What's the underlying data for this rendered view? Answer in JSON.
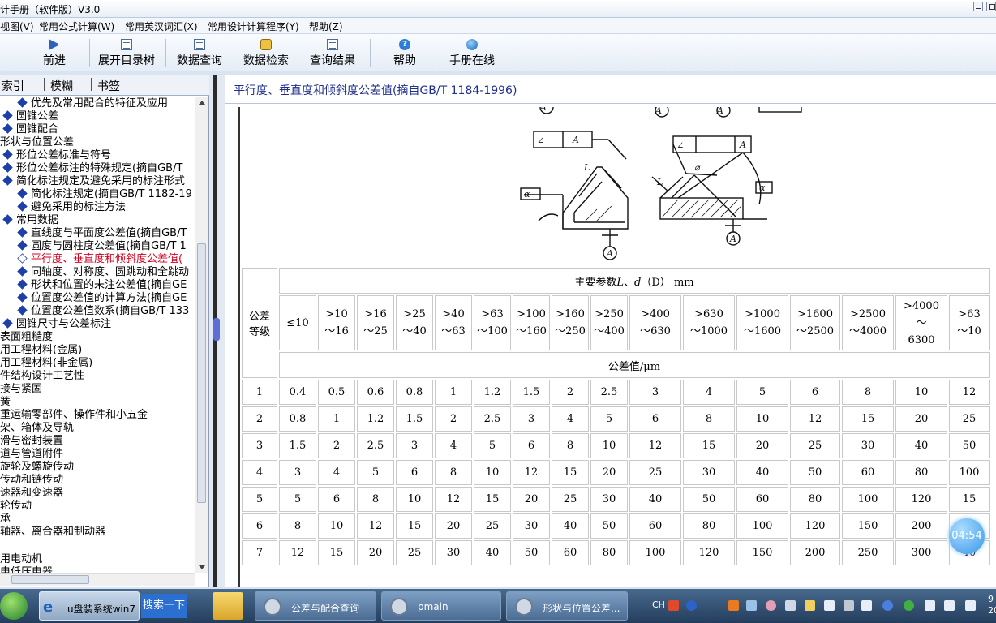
{
  "window": {
    "title": "计手册（软件版）V3.0"
  },
  "menu": [
    "视图(V)",
    "常用公式计算(W)",
    "常用英汉词汇(X)",
    "常用设计计算程序(Y)",
    "帮助(Z)"
  ],
  "toolbar": {
    "forward": "前进",
    "expand": "展开目录树",
    "query": "数据查询",
    "search": "数据检索",
    "result": "查询结果",
    "help": "帮助",
    "online": "手册在线"
  },
  "tabs": [
    "索引",
    "模糊",
    "书签"
  ],
  "tree": [
    {
      "label": "优先及常用配合的特征及应用",
      "level": 2
    },
    {
      "label": "圆锥公差",
      "level": 1
    },
    {
      "label": "圆锥配合",
      "level": 1
    },
    {
      "label": "形状与位置公差",
      "level": 0
    },
    {
      "label": "形位公差标准与符号",
      "level": 1
    },
    {
      "label": "形位公差标注的特殊规定(摘自GB/T",
      "level": 1
    },
    {
      "label": "简化标注规定及避免采用的标注形式",
      "level": 1
    },
    {
      "label": "简化标注规定(摘自GB/T 1182-19",
      "level": 2
    },
    {
      "label": "避免采用的标注方法",
      "level": 2
    },
    {
      "label": "常用数据",
      "level": 1
    },
    {
      "label": "直线度与平面度公差值(摘自GB/T",
      "level": 2
    },
    {
      "label": "圆度与圆柱度公差值(摘自GB/T 1",
      "level": 2
    },
    {
      "label": "平行度、垂直度和倾斜度公差值(",
      "level": 2,
      "selected": true
    },
    {
      "label": "同轴度、对称度、圆跳动和全跳动",
      "level": 2
    },
    {
      "label": "形状和位置的未注公差值(摘自GE",
      "level": 2
    },
    {
      "label": "位置度公差值的计算方法(摘自GE",
      "level": 2
    },
    {
      "label": "位置度公差值数系(摘自GB/T 133",
      "level": 2
    },
    {
      "label": "圆锥尺寸与公差标注",
      "level": 1
    },
    {
      "label": "表面粗糙度",
      "level": 0
    },
    {
      "label": "用工程材料(金属)",
      "level": 0
    },
    {
      "label": "用工程材料(非金属)",
      "level": 0
    },
    {
      "label": "件结构设计工艺性",
      "level": 0
    },
    {
      "label": "接与紧固",
      "level": 0
    },
    {
      "label": "簧",
      "level": 0
    },
    {
      "label": "重运输零部件、操作件和小五金",
      "level": 0
    },
    {
      "label": "架、箱体及导轨",
      "level": 0
    },
    {
      "label": "滑与密封装置",
      "level": 0
    },
    {
      "label": "道与管道附件",
      "level": 0
    },
    {
      "label": "旋轮及螺旋传动",
      "level": 0
    },
    {
      "label": "传动和链传动",
      "level": 0
    },
    {
      "label": "速器和变速器",
      "level": 0
    },
    {
      "label": "轮传动",
      "level": 0
    },
    {
      "label": "承",
      "level": 0
    },
    {
      "label": "轴器、离合器和制动器",
      "level": 0
    },
    {
      "label": "",
      "level": 0
    },
    {
      "label": "用电动机",
      "level": 0
    },
    {
      "label": "电低压电器",
      "level": 0
    }
  ],
  "content": {
    "heading": "平行度、垂直度和倾斜度公差值(摘自GB/T 1184-1996)",
    "figure": {
      "datum": "A",
      "alpha": "α",
      "length": "L",
      "phi": "⌀",
      "angle_symbol": "∠"
    },
    "table": {
      "grade_header": "公差\n等级",
      "main_param_prefix": "主要参数",
      "main_param_L": "L",
      "main_param_sep": "、",
      "main_param_d": "d",
      "main_param_D": "（D）",
      "main_param_unit": " mm",
      "tol_header": "公差值/μm",
      "ranges": [
        "≤10",
        ">10\n～16",
        ">16\n～25",
        ">25\n～40",
        ">40\n～63",
        ">63\n～100",
        ">100\n～160",
        ">160\n～250",
        ">250\n～400",
        ">400\n～630",
        ">630\n～1000",
        ">1000\n～1600",
        ">1600\n～2500",
        ">2500\n～4000",
        ">4000\n～\n6300",
        ">63\n～10"
      ],
      "rows": [
        [
          "1",
          "0.4",
          "0.5",
          "0.6",
          "0.8",
          "1",
          "1.2",
          "1.5",
          "2",
          "2.5",
          "3",
          "4",
          "5",
          "6",
          "8",
          "10",
          "12"
        ],
        [
          "2",
          "0.8",
          "1",
          "1.2",
          "1.5",
          "2",
          "2.5",
          "3",
          "4",
          "5",
          "6",
          "8",
          "10",
          "12",
          "15",
          "20",
          "25"
        ],
        [
          "3",
          "1.5",
          "2",
          "2.5",
          "3",
          "4",
          "5",
          "6",
          "8",
          "10",
          "12",
          "15",
          "20",
          "25",
          "30",
          "40",
          "50"
        ],
        [
          "4",
          "3",
          "4",
          "5",
          "6",
          "8",
          "10",
          "12",
          "15",
          "20",
          "25",
          "30",
          "40",
          "50",
          "60",
          "80",
          "100"
        ],
        [
          "5",
          "5",
          "6",
          "8",
          "10",
          "12",
          "15",
          "20",
          "25",
          "30",
          "40",
          "50",
          "60",
          "80",
          "100",
          "120",
          "15"
        ],
        [
          "6",
          "8",
          "10",
          "12",
          "15",
          "20",
          "25",
          "30",
          "40",
          "50",
          "60",
          "80",
          "100",
          "120",
          "150",
          "200",
          "25"
        ],
        [
          "7",
          "12",
          "15",
          "20",
          "25",
          "30",
          "40",
          "50",
          "60",
          "80",
          "100",
          "120",
          "150",
          "200",
          "250",
          "300",
          "40"
        ]
      ]
    }
  },
  "clock_bubble": "04:54",
  "taskbar": {
    "ie_label": "u盘装系统win7",
    "search": "搜索一下",
    "tasks": [
      "公差与配合查询",
      "pmain",
      "形状与位置公差..."
    ],
    "tray_lang": "CH",
    "tray_time": "9",
    "tray_date": "20"
  }
}
